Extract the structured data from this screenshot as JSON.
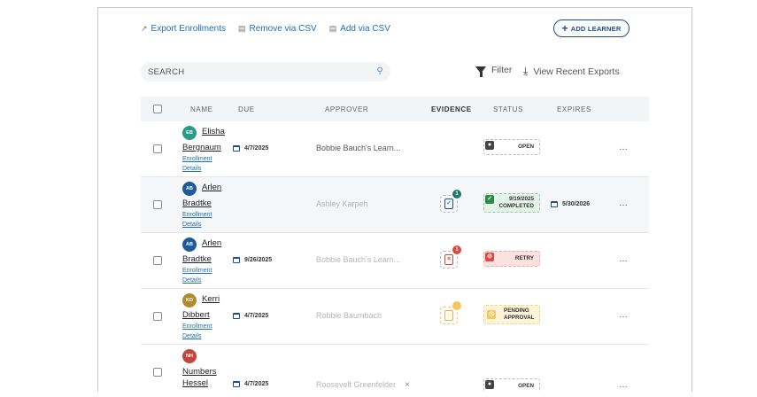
{
  "toolbar": {
    "export_label": "Export Enrollments",
    "remove_label": "Remove via CSV",
    "add_csv_label": "Add via CSV",
    "add_learner_label": "ADD LEARNER"
  },
  "search": {
    "placeholder": "SEARCH"
  },
  "filter_label": "Filter",
  "exports_label": "View Recent Exports",
  "columns": {
    "name": "NAME",
    "due": "DUE",
    "approver": "APPROVER",
    "evidence": "EVIDENCE",
    "status": "STATUS",
    "expires": "EXPIRES"
  },
  "rows": [
    {
      "initials": "EB",
      "first": "Elisha",
      "last": "Bergnaum",
      "avatar_color": "#2a9a8c",
      "link": "Enrollment Details",
      "due": "4/7/2025",
      "approver": "Bobbie Bauch's Learn...",
      "status_line1": "OPEN",
      "status_line2": "",
      "status_kind": "open",
      "expires": "",
      "evidence_count": ""
    },
    {
      "initials": "AB",
      "first": "Arlen",
      "last": "Bradtke",
      "avatar_color": "#1e5a9c",
      "link": "Enrollment Details",
      "due": "",
      "approver": "Ashley Karpeh",
      "status_line1": "9/19/2025",
      "status_line2": "COMPLETED",
      "status_kind": "completed",
      "expires": "5/30/2026",
      "evidence_count": "1"
    },
    {
      "initials": "AB",
      "first": "Arlen",
      "last": "Bradtke",
      "avatar_color": "#1e5a9c",
      "link": "Enrollment Details",
      "due": "9/26/2025",
      "approver": "Bobbie Bauch's Learn...",
      "status_line1": "RETRY",
      "status_line2": "",
      "status_kind": "retry",
      "expires": "",
      "evidence_count": "1"
    },
    {
      "initials": "KD",
      "first": "Kerri",
      "last": "Dibbert",
      "avatar_color": "#b08a2e",
      "link": "Enrollment Details",
      "due": "4/7/2025",
      "approver": "Robbie Baumbach",
      "status_line1": "PENDING",
      "status_line2": "APPROVAL",
      "status_kind": "pending",
      "expires": "",
      "evidence_count": ""
    },
    {
      "initials": "NH",
      "first": "Numbers",
      "last": "Hessel",
      "avatar_color": "#c4453a",
      "link": "",
      "due": "4/7/2025",
      "approver": "Roosevelt Greenfelder",
      "status_line1": "OPEN",
      "status_line2": "",
      "status_kind": "open",
      "expires": "",
      "evidence_count": ""
    }
  ],
  "more_label": "…"
}
